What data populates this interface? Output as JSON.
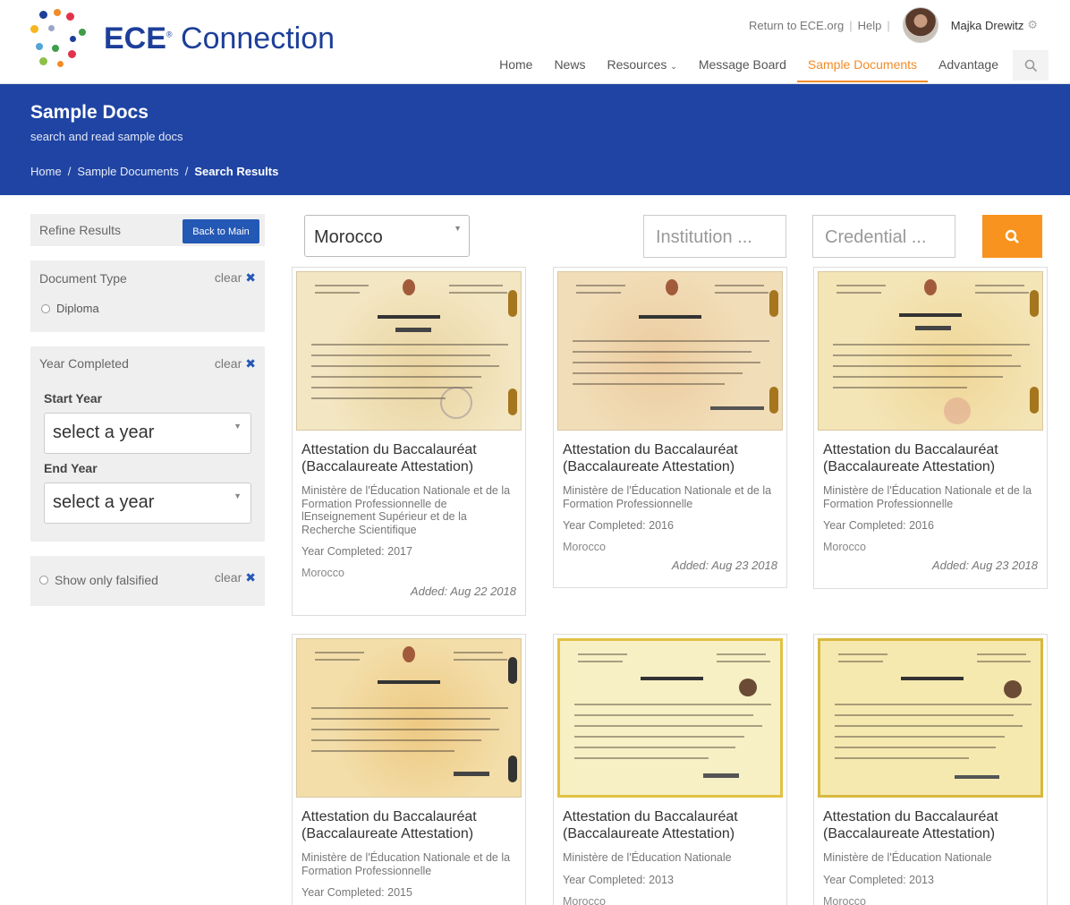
{
  "header": {
    "brand": "ECE",
    "brand_suffix": "Connection",
    "return_link": "Return to ECE.org",
    "help_link": "Help",
    "user_name": "Majka Drewitz",
    "nav": [
      "Home",
      "News",
      "Resources",
      "Message Board",
      "Sample Documents",
      "Advantage"
    ],
    "active_nav": "Sample Documents"
  },
  "banner": {
    "title": "Sample Docs",
    "subtitle": "search and read sample docs",
    "breadcrumbs": [
      "Home",
      "Sample Documents",
      "Search Results"
    ]
  },
  "sidebar": {
    "refine_label": "Refine Results",
    "back_button": "Back to Main",
    "document_type": {
      "label": "Document Type",
      "clear": "clear",
      "option": "Diploma"
    },
    "year_completed": {
      "label": "Year Completed",
      "clear": "clear",
      "start_label": "Start Year",
      "start_value": "select a year",
      "end_label": "End Year",
      "end_value": "select a year"
    },
    "falsified": {
      "label": "Show only falsified",
      "clear": "clear"
    }
  },
  "filters": {
    "country": "Morocco",
    "institution_placeholder": "Institution ...",
    "credential_placeholder": "Credential ..."
  },
  "results": [
    {
      "title": "Attestation du Baccalauréat (Baccalaureate Attestation)",
      "institution": "Ministère de l'Éducation Nationale et de la Formation Professionnelle de lEnseignement Supérieur et de la Recherche Scientifique",
      "year": "Year Completed: 2017",
      "country": "Morocco",
      "added": "Added: Aug 22 2018"
    },
    {
      "title": "Attestation du Baccalauréat (Baccalaureate Attestation)",
      "institution": "Ministère de l'Éducation Nationale et de la Formation Professionnelle",
      "year": "Year Completed: 2016",
      "country": "Morocco",
      "added": "Added: Aug 23 2018"
    },
    {
      "title": "Attestation du Baccalauréat (Baccalaureate Attestation)",
      "institution": "Ministère de l'Éducation Nationale et de la Formation Professionnelle",
      "year": "Year Completed: 2016",
      "country": "Morocco",
      "added": "Added: Aug 23 2018"
    },
    {
      "title": "Attestation du Baccalauréat (Baccalaureate Attestation)",
      "institution": "Ministère de l'Éducation Nationale et de la Formation Professionnelle",
      "year": "Year Completed: 2015",
      "country": "",
      "added": ""
    },
    {
      "title": "Attestation du Baccalauréat (Baccalaureate Attestation)",
      "institution": "Ministère de l'Éducation Nationale",
      "year": "Year Completed: 2013",
      "country": "Morocco",
      "added": ""
    },
    {
      "title": "Attestation du Baccalauréat (Baccalaureate Attestation)",
      "institution": "Ministère de l'Éducation Nationale",
      "year": "Year Completed: 2013",
      "country": "Morocco",
      "added": ""
    }
  ],
  "colors": {
    "brand_blue": "#1f44a3",
    "accent_orange": "#f7931e",
    "button_blue": "#2458b5"
  }
}
